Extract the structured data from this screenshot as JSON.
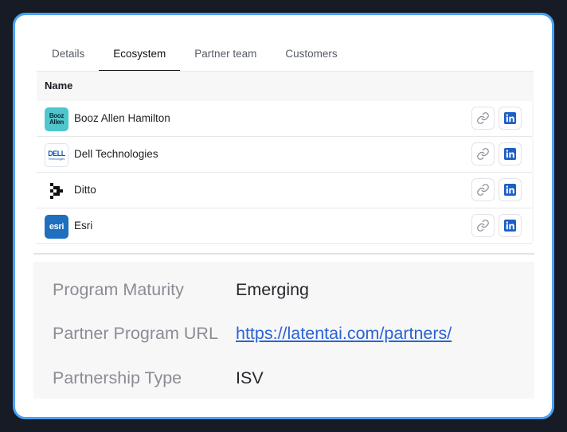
{
  "tabs": [
    {
      "label": "Details",
      "active": false
    },
    {
      "label": "Ecosystem",
      "active": true
    },
    {
      "label": "Partner team",
      "active": false
    },
    {
      "label": "Customers",
      "active": false
    }
  ],
  "table": {
    "column_header": "Name",
    "rows": [
      {
        "name": "Booz Allen Hamilton",
        "logo_icon": "booz-allen-logo",
        "logo_text": [
          "Booz",
          "Allen"
        ]
      },
      {
        "name": "Dell Technologies",
        "logo_icon": "dell-logo",
        "logo_text": [
          "DELL",
          "Technologies"
        ]
      },
      {
        "name": "Ditto",
        "logo_icon": "ditto-logo"
      },
      {
        "name": "Esri",
        "logo_icon": "esri-logo",
        "logo_text": [
          "esri"
        ]
      }
    ],
    "row_actions": {
      "link_icon": "link-icon",
      "linkedin_icon": "linkedin-icon"
    }
  },
  "details": [
    {
      "label": "Program Maturity",
      "value": "Emerging"
    },
    {
      "label": "Partner Program URL",
      "value": "https://latentai.com/partners/"
    },
    {
      "label": "Partnership Type",
      "value": "ISV"
    }
  ],
  "colors": {
    "frame_border": "#4aa3f5",
    "link": "#2a63d4",
    "linkedin": "#1d5fc4"
  }
}
